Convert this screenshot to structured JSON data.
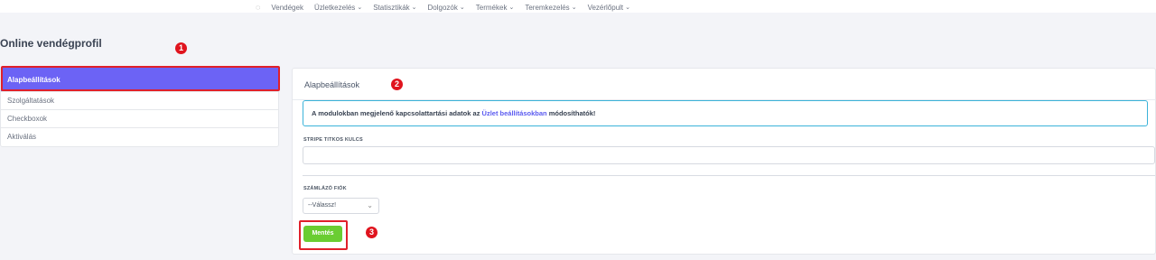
{
  "nav": {
    "home_icon": "spinner-icon",
    "items": [
      {
        "label": "Vendégek",
        "dropdown": false
      },
      {
        "label": "Üzletkezelés",
        "dropdown": true
      },
      {
        "label": "Statisztikák",
        "dropdown": true
      },
      {
        "label": "Dolgozók",
        "dropdown": true
      },
      {
        "label": "Termékek",
        "dropdown": true
      },
      {
        "label": "Teremkezelés",
        "dropdown": true
      },
      {
        "label": "Vezérlőpult",
        "dropdown": true
      }
    ]
  },
  "page": {
    "title": "Online vendégprofil"
  },
  "sidebar": {
    "items": [
      {
        "label": "Alapbeállítások",
        "active": true
      },
      {
        "label": "Szolgáltatások",
        "active": false
      },
      {
        "label": "Checkboxok",
        "active": false
      },
      {
        "label": "Aktiválás",
        "active": false
      }
    ]
  },
  "badges": {
    "b1": "1",
    "b2": "2",
    "b3": "3"
  },
  "card": {
    "title": "Alapbeállítások",
    "info_prefix": "A modulokban megjelenő kapcsolattartási adatok az ",
    "info_link": "Üzlet beállításokban",
    "info_suffix": " módosíthatók!",
    "stripe_label": "STRIPE TITKOS KULCS",
    "stripe_value": "",
    "billing_label": "SZÁMLÁZÓ FIÓK",
    "billing_selected": "--Válassz!",
    "save_label": "Mentés"
  },
  "colors": {
    "accent": "#6c63f5",
    "save": "#6acd32",
    "info_border": "#3bb3d9",
    "annotation": "#e0202a"
  }
}
